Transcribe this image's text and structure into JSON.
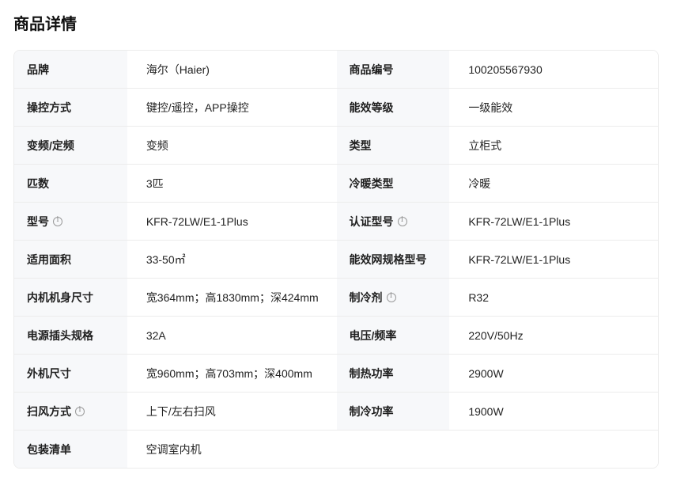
{
  "page_title": "商品详情",
  "rows": [
    {
      "l1": "品牌",
      "v1": "海尔（Haier)",
      "l2": "商品编号",
      "v2": "100205567930"
    },
    {
      "l1": "操控方式",
      "v1": "键控/遥控，APP操控",
      "l2": "能效等级",
      "v2": "一级能效"
    },
    {
      "l1": "变频/定频",
      "v1": "变频",
      "l2": "类型",
      "v2": "立柜式"
    },
    {
      "l1": "匹数",
      "v1": "3匹",
      "l2": "冷暖类型",
      "v2": "冷暖"
    },
    {
      "l1": "型号",
      "v1": "KFR-72LW/E1-1Plus",
      "l2": "认证型号",
      "v2": "KFR-72LW/E1-1Plus"
    },
    {
      "l1": "适用面积",
      "v1": "33-50㎡",
      "l2": "能效网规格型号",
      "v2": "KFR-72LW/E1-1Plus"
    },
    {
      "l1": "内机机身尺寸",
      "v1": "宽364mm；高1830mm；深424mm",
      "l2": "制冷剂",
      "v2": "R32"
    },
    {
      "l1": "电源插头规格",
      "v1": "32A",
      "l2": "电压/频率",
      "v2": "220V/50Hz"
    },
    {
      "l1": "外机尺寸",
      "v1": "宽960mm；高703mm；深400mm",
      "l2": "制热功率",
      "v2": "2900W"
    },
    {
      "l1": "扫风方式",
      "v1": "上下/左右扫风",
      "l2": "制冷功率",
      "v2": "1900W"
    },
    {
      "l1": "包装清单",
      "v1": "空调室内机"
    }
  ],
  "icons": {
    "info": "info-circle-icon"
  }
}
